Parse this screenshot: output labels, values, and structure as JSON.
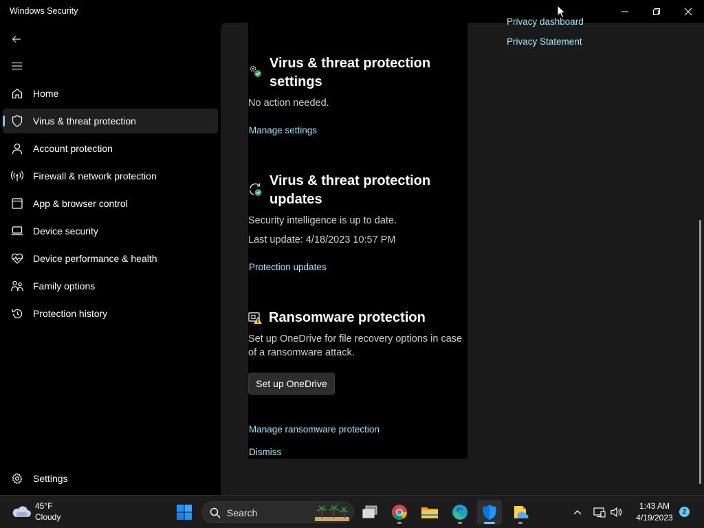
{
  "window": {
    "title": "Windows Security"
  },
  "sidebar": {
    "items": [
      {
        "label": "Home",
        "icon": "home-icon"
      },
      {
        "label": "Virus & threat protection",
        "icon": "shield-icon",
        "active": true
      },
      {
        "label": "Account protection",
        "icon": "person-icon"
      },
      {
        "label": "Firewall & network protection",
        "icon": "wireless-icon"
      },
      {
        "label": "App & browser control",
        "icon": "app-window-icon"
      },
      {
        "label": "Device security",
        "icon": "laptop-icon"
      },
      {
        "label": "Device performance & health",
        "icon": "heart-pulse-icon"
      },
      {
        "label": "Family options",
        "icon": "family-icon"
      },
      {
        "label": "Protection history",
        "icon": "history-icon"
      }
    ],
    "settings_label": "Settings"
  },
  "main": {
    "settings_section": {
      "title": "Virus & threat protection settings",
      "status": "No action needed.",
      "link": "Manage settings"
    },
    "updates_section": {
      "title": "Virus & threat protection updates",
      "status": "Security intelligence is up to date.",
      "last_update": "Last update: 4/18/2023 10:57 PM",
      "link": "Protection updates"
    },
    "ransomware_section": {
      "title": "Ransomware protection",
      "description": "Set up OneDrive for file recovery options in case of a ransomware attack.",
      "button": "Set up OneDrive",
      "link_manage": "Manage ransomware protection",
      "link_dismiss": "Dismiss"
    }
  },
  "right_panel": {
    "link_dashboard": "Privacy dashboard",
    "link_statement": "Privacy Statement"
  },
  "taskbar": {
    "weather": {
      "temp": "45°F",
      "condition": "Cloudy"
    },
    "search_label": "Search",
    "time": "1:43 AM",
    "date": "4/19/2023",
    "notifications": "2"
  },
  "colors": {
    "accent": "#60cdff",
    "link": "#99ebff"
  }
}
